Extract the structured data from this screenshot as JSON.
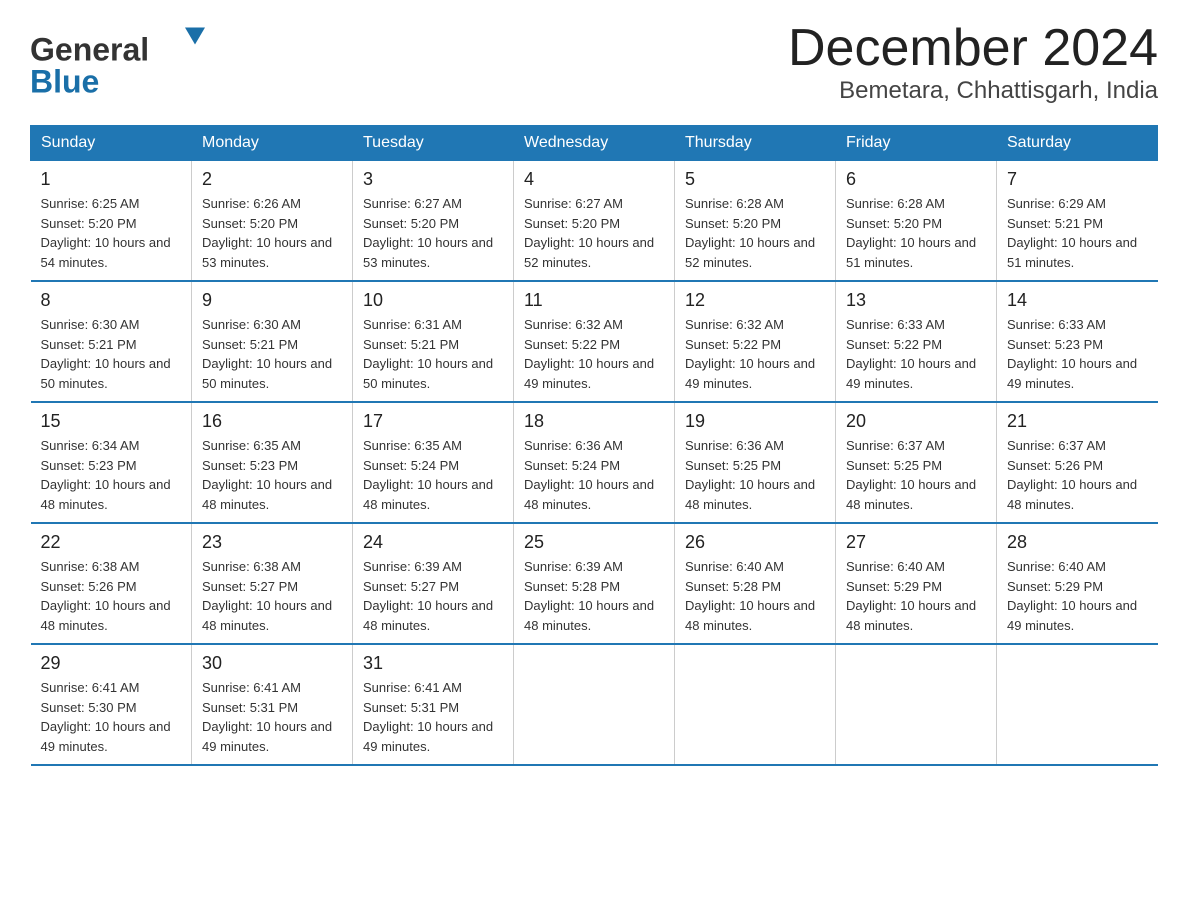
{
  "header": {
    "logo_line1": "General",
    "logo_line2": "Blue",
    "month_title": "December 2024",
    "location": "Bemetara, Chhattisgarh, India"
  },
  "days_of_week": [
    "Sunday",
    "Monday",
    "Tuesday",
    "Wednesday",
    "Thursday",
    "Friday",
    "Saturday"
  ],
  "weeks": [
    [
      {
        "day": "1",
        "sunrise": "6:25 AM",
        "sunset": "5:20 PM",
        "daylight": "10 hours and 54 minutes."
      },
      {
        "day": "2",
        "sunrise": "6:26 AM",
        "sunset": "5:20 PM",
        "daylight": "10 hours and 53 minutes."
      },
      {
        "day": "3",
        "sunrise": "6:27 AM",
        "sunset": "5:20 PM",
        "daylight": "10 hours and 53 minutes."
      },
      {
        "day": "4",
        "sunrise": "6:27 AM",
        "sunset": "5:20 PM",
        "daylight": "10 hours and 52 minutes."
      },
      {
        "day": "5",
        "sunrise": "6:28 AM",
        "sunset": "5:20 PM",
        "daylight": "10 hours and 52 minutes."
      },
      {
        "day": "6",
        "sunrise": "6:28 AM",
        "sunset": "5:20 PM",
        "daylight": "10 hours and 51 minutes."
      },
      {
        "day": "7",
        "sunrise": "6:29 AM",
        "sunset": "5:21 PM",
        "daylight": "10 hours and 51 minutes."
      }
    ],
    [
      {
        "day": "8",
        "sunrise": "6:30 AM",
        "sunset": "5:21 PM",
        "daylight": "10 hours and 50 minutes."
      },
      {
        "day": "9",
        "sunrise": "6:30 AM",
        "sunset": "5:21 PM",
        "daylight": "10 hours and 50 minutes."
      },
      {
        "day": "10",
        "sunrise": "6:31 AM",
        "sunset": "5:21 PM",
        "daylight": "10 hours and 50 minutes."
      },
      {
        "day": "11",
        "sunrise": "6:32 AM",
        "sunset": "5:22 PM",
        "daylight": "10 hours and 49 minutes."
      },
      {
        "day": "12",
        "sunrise": "6:32 AM",
        "sunset": "5:22 PM",
        "daylight": "10 hours and 49 minutes."
      },
      {
        "day": "13",
        "sunrise": "6:33 AM",
        "sunset": "5:22 PM",
        "daylight": "10 hours and 49 minutes."
      },
      {
        "day": "14",
        "sunrise": "6:33 AM",
        "sunset": "5:23 PM",
        "daylight": "10 hours and 49 minutes."
      }
    ],
    [
      {
        "day": "15",
        "sunrise": "6:34 AM",
        "sunset": "5:23 PM",
        "daylight": "10 hours and 48 minutes."
      },
      {
        "day": "16",
        "sunrise": "6:35 AM",
        "sunset": "5:23 PM",
        "daylight": "10 hours and 48 minutes."
      },
      {
        "day": "17",
        "sunrise": "6:35 AM",
        "sunset": "5:24 PM",
        "daylight": "10 hours and 48 minutes."
      },
      {
        "day": "18",
        "sunrise": "6:36 AM",
        "sunset": "5:24 PM",
        "daylight": "10 hours and 48 minutes."
      },
      {
        "day": "19",
        "sunrise": "6:36 AM",
        "sunset": "5:25 PM",
        "daylight": "10 hours and 48 minutes."
      },
      {
        "day": "20",
        "sunrise": "6:37 AM",
        "sunset": "5:25 PM",
        "daylight": "10 hours and 48 minutes."
      },
      {
        "day": "21",
        "sunrise": "6:37 AM",
        "sunset": "5:26 PM",
        "daylight": "10 hours and 48 minutes."
      }
    ],
    [
      {
        "day": "22",
        "sunrise": "6:38 AM",
        "sunset": "5:26 PM",
        "daylight": "10 hours and 48 minutes."
      },
      {
        "day": "23",
        "sunrise": "6:38 AM",
        "sunset": "5:27 PM",
        "daylight": "10 hours and 48 minutes."
      },
      {
        "day": "24",
        "sunrise": "6:39 AM",
        "sunset": "5:27 PM",
        "daylight": "10 hours and 48 minutes."
      },
      {
        "day": "25",
        "sunrise": "6:39 AM",
        "sunset": "5:28 PM",
        "daylight": "10 hours and 48 minutes."
      },
      {
        "day": "26",
        "sunrise": "6:40 AM",
        "sunset": "5:28 PM",
        "daylight": "10 hours and 48 minutes."
      },
      {
        "day": "27",
        "sunrise": "6:40 AM",
        "sunset": "5:29 PM",
        "daylight": "10 hours and 48 minutes."
      },
      {
        "day": "28",
        "sunrise": "6:40 AM",
        "sunset": "5:29 PM",
        "daylight": "10 hours and 49 minutes."
      }
    ],
    [
      {
        "day": "29",
        "sunrise": "6:41 AM",
        "sunset": "5:30 PM",
        "daylight": "10 hours and 49 minutes."
      },
      {
        "day": "30",
        "sunrise": "6:41 AM",
        "sunset": "5:31 PM",
        "daylight": "10 hours and 49 minutes."
      },
      {
        "day": "31",
        "sunrise": "6:41 AM",
        "sunset": "5:31 PM",
        "daylight": "10 hours and 49 minutes."
      },
      {
        "day": "",
        "sunrise": "",
        "sunset": "",
        "daylight": ""
      },
      {
        "day": "",
        "sunrise": "",
        "sunset": "",
        "daylight": ""
      },
      {
        "day": "",
        "sunrise": "",
        "sunset": "",
        "daylight": ""
      },
      {
        "day": "",
        "sunrise": "",
        "sunset": "",
        "daylight": ""
      }
    ]
  ],
  "labels": {
    "sunrise_prefix": "Sunrise: ",
    "sunset_prefix": "Sunset: ",
    "daylight_prefix": "Daylight: "
  }
}
